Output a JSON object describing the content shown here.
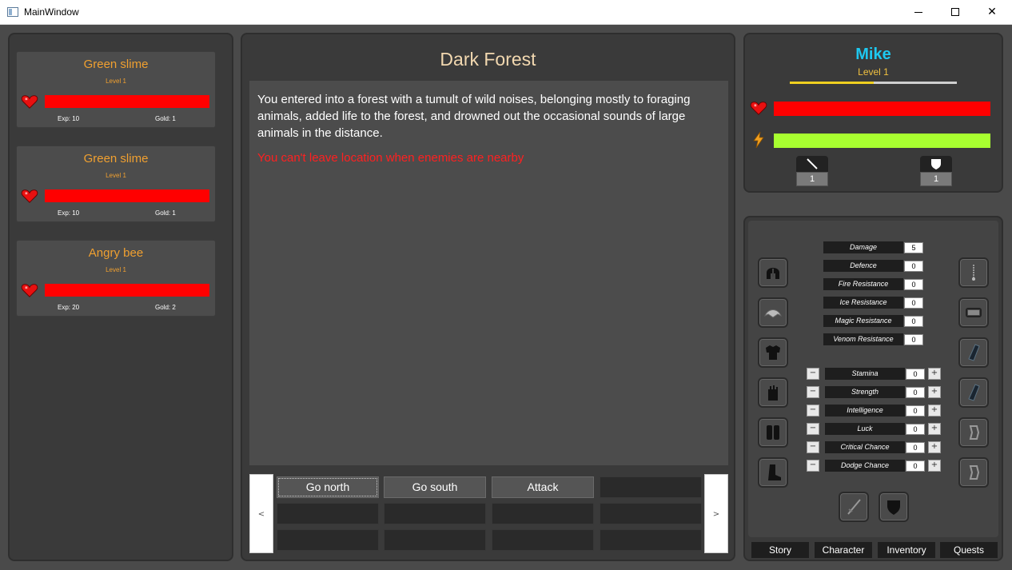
{
  "window": {
    "title": "MainWindow"
  },
  "colors": {
    "enemy_name": "#f0a030",
    "hp_bar": "#ff0000",
    "energy_bar": "#a8ff30",
    "player_name": "#1ec8f0",
    "warning": "#ff2020",
    "location_title": "#f2d8b0"
  },
  "enemies": [
    {
      "name": "Green slime",
      "level": "Level 1",
      "exp": "Exp: 10",
      "gold": "Gold: 1",
      "hp_fraction": 1.0
    },
    {
      "name": "Green slime",
      "level": "Level 1",
      "exp": "Exp: 10",
      "gold": "Gold: 1",
      "hp_fraction": 1.0
    },
    {
      "name": "Angry bee",
      "level": "Level 1",
      "exp": "Exp: 20",
      "gold": "Gold: 2",
      "hp_fraction": 1.0
    }
  ],
  "location": {
    "title": "Dark Forest",
    "description": "You entered into a forest with a tumult of wild noises, belonging mostly to foraging animals, added life to the forest, and drowned out the occasional sounds of large animals in the distance.",
    "warning": "You can't leave location when enemies are nearby"
  },
  "navigation": {
    "prev": "<",
    "next": ">"
  },
  "actions": [
    [
      "Go north",
      "Go south",
      "Attack",
      ""
    ],
    [
      "",
      "",
      "",
      ""
    ],
    [
      "",
      "",
      "",
      ""
    ]
  ],
  "player": {
    "name": "Mike",
    "level": "Level 1",
    "xp_fraction": 0.5,
    "hp_fraction": 1.0,
    "energy_fraction": 1.0,
    "attack_value": "1",
    "defence_value": "1"
  },
  "character": {
    "stats": [
      {
        "label": "Damage",
        "value": "5"
      },
      {
        "label": "Defence",
        "value": "0"
      },
      {
        "label": "Fire Resistance",
        "value": "0"
      },
      {
        "label": "Ice Resistance",
        "value": "0"
      },
      {
        "label": "Magic Resistance",
        "value": "0"
      },
      {
        "label": "Venom Resistance",
        "value": "0"
      }
    ],
    "attributes": [
      {
        "label": "Stamina",
        "value": "0"
      },
      {
        "label": "Strength",
        "value": "0"
      },
      {
        "label": "Intelligence",
        "value": "0"
      },
      {
        "label": "Luck",
        "value": "0"
      },
      {
        "label": "Critical Chance",
        "value": "0"
      },
      {
        "label": "Dodge Chance",
        "value": "0"
      }
    ],
    "minus": "−",
    "plus": "+",
    "left_slots": [
      "helmet-icon",
      "shoulders-icon",
      "chest-armor-icon",
      "gloves-icon",
      "belt-icon",
      "boots-icon"
    ],
    "right_slots": [
      "amulet-icon",
      "bracer-icon",
      "bracer-left-icon",
      "bracer-right-icon",
      "ring-icon",
      "ring-icon"
    ],
    "weapon_slots": [
      "sword-icon",
      "shield-icon"
    ]
  },
  "tabs": [
    "Story",
    "Character",
    "Inventory",
    "Quests"
  ]
}
